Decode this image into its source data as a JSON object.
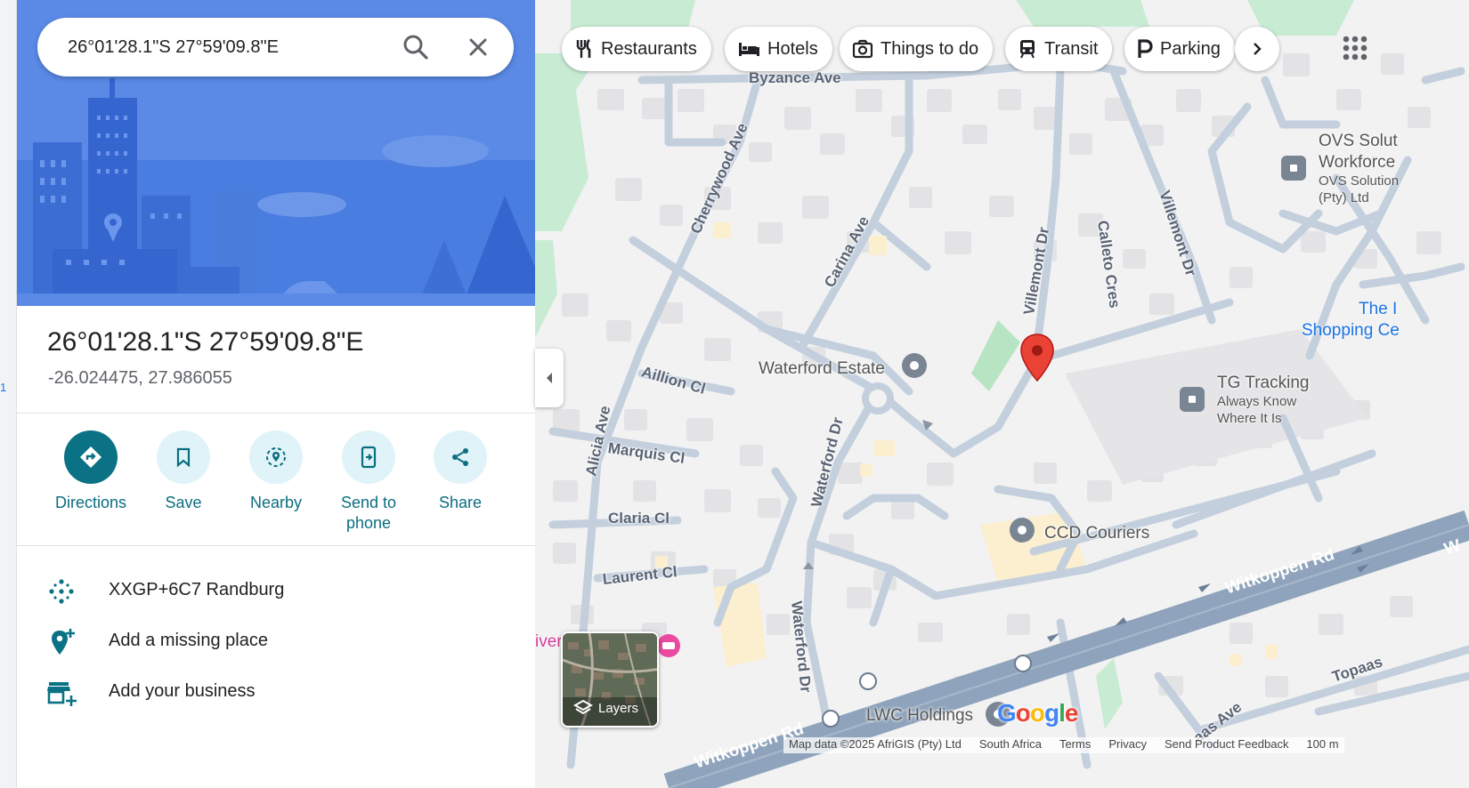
{
  "search": {
    "value": "26°01'28.1\"S 27°59'09.8\"E"
  },
  "left_strip": {
    "number": "1"
  },
  "place": {
    "title": "26°01'28.1\"S 27°59'09.8\"E",
    "coordinates": "-26.024475, 27.986055"
  },
  "actions": [
    {
      "label": "Directions",
      "icon": "directions-icon"
    },
    {
      "label": "Save",
      "icon": "bookmark-icon"
    },
    {
      "label": "Nearby",
      "icon": "nearby-icon"
    },
    {
      "label": "Send to\nphone",
      "icon": "send-to-phone-icon"
    },
    {
      "label": "Share",
      "icon": "share-icon"
    }
  ],
  "info": [
    {
      "text": "XXGP+6C7 Randburg",
      "icon": "plus-code-icon"
    },
    {
      "text": "Add a missing place",
      "icon": "add-place-icon"
    },
    {
      "text": "Add your business",
      "icon": "add-business-icon"
    }
  ],
  "chips": [
    {
      "label": "Restaurants",
      "icon": "restaurant-icon"
    },
    {
      "label": "Hotels",
      "icon": "hotel-icon"
    },
    {
      "label": "Things to do",
      "icon": "camera-icon"
    },
    {
      "label": "Transit",
      "icon": "transit-icon"
    },
    {
      "label": "Parking",
      "icon": "parking-icon"
    }
  ],
  "streets": {
    "byzance": "Byzance Ave",
    "cherrywood": "Cherrywood Ave",
    "carina": "Carina Ave",
    "villemont1": "Villemont Dr",
    "calleto": "Calleto Cres",
    "villemont2": "Villemont Dr",
    "aillion": "Aillion Cl",
    "alicia": "Alicia Ave",
    "marquis": "Marquis Cl",
    "waterford1": "Waterford Dr",
    "claria": "Claria Cl",
    "laurent": "Laurent Cl",
    "waterford2": "Waterford Dr",
    "witkoppen1": "Witkoppen Rd",
    "witkoppen2": "Witkoppen Rd",
    "witkoppen_cut": "W",
    "topaas": "Topaas",
    "aas": "aas Ave"
  },
  "pois": {
    "waterford_estate": "Waterford Estate",
    "ovs_title_1": "OVS Solut",
    "ovs_title_2": "Workforce",
    "ovs_sub_1": "OVS Solution",
    "ovs_sub_2": "(Pty) Ltd",
    "shopping_1": "The I",
    "shopping_2": "Shopping Ce",
    "tg_title": "TG Tracking",
    "tg_sub_1": "Always Know",
    "tg_sub_2": "Where It Is",
    "ccd": "CCD Couriers",
    "lwc": "LWC Holdings",
    "river_cut": "iver"
  },
  "map_controls": {
    "layers": "Layers"
  },
  "logo": "Google",
  "attribution": [
    "Map data ©2025 AfriGIS (Pty) Ltd",
    "South Africa",
    "Terms",
    "Privacy",
    "Send Product Feedback",
    "100 m"
  ],
  "colors": {
    "accent": "#0b7285",
    "pin": "#ea4335",
    "major_road": "#8fa4bc",
    "minor_road": "#c3cfdd",
    "park": "#c8ecd3"
  }
}
